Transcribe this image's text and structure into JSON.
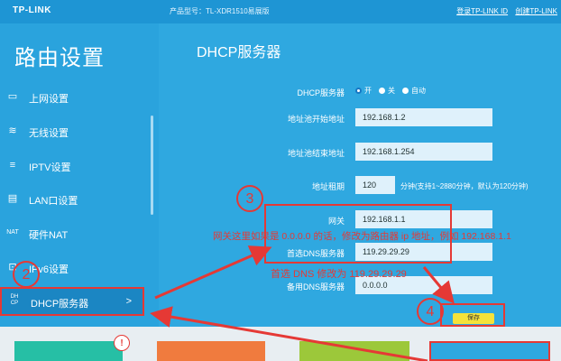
{
  "header": {
    "logo": "TP-LINK",
    "model": "产品型号：TL-XDR1510易展版",
    "links": [
      "登录TP-LINK ID",
      "创建TP-LINK"
    ]
  },
  "sidebar": {
    "title": "路由设置",
    "items": [
      {
        "label": "上网设置",
        "icon": "laptop-icon"
      },
      {
        "label": "无线设置",
        "icon": "wifi-icon"
      },
      {
        "label": "IPTV设置",
        "icon": "tv-icon"
      },
      {
        "label": "LAN口设置",
        "icon": "lan-icon"
      },
      {
        "label": "硬件NAT",
        "icon": "nat-icon"
      },
      {
        "label": "IPv6设置",
        "icon": "ipv6-icon"
      },
      {
        "label": "DHCP服务器",
        "icon": "dhcp-icon",
        "arrow": ">"
      }
    ]
  },
  "main": {
    "title": "DHCP服务器",
    "dhcp_label": "DHCP服务器",
    "dhcp_options": [
      "开",
      "关",
      "自动"
    ],
    "dhcp_selected": "开",
    "fields": {
      "pool_start_label": "地址池开始地址",
      "pool_start": "192.168.1.2",
      "pool_end_label": "地址池结束地址",
      "pool_end": "192.168.1.254",
      "lease_label": "地址租期",
      "lease": "120",
      "lease_hint": "分钟(支持1~2880分钟，默认为120分钟)",
      "gateway_label": "网关",
      "gateway": "192.168.1.1",
      "dns1_label": "首选DNS服务器",
      "dns1": "119.29.29.29",
      "dns2_label": "备用DNS服务器",
      "dns2": "0.0.0.0"
    },
    "save": "保存"
  },
  "annotations": {
    "n2": "2",
    "n3": "3",
    "n4": "4",
    "n1": "!",
    "note_gateway": "网关这里如果是 0.0.0.0 的话，修改为路由器 ip 地址，例如 192.168.1.1",
    "note_dns": "首选 DNS 修改为 119.29.29.29"
  },
  "colors": {
    "accent": "#2fa8e0",
    "annotation": "#e53935",
    "save": "#f5e23a"
  }
}
